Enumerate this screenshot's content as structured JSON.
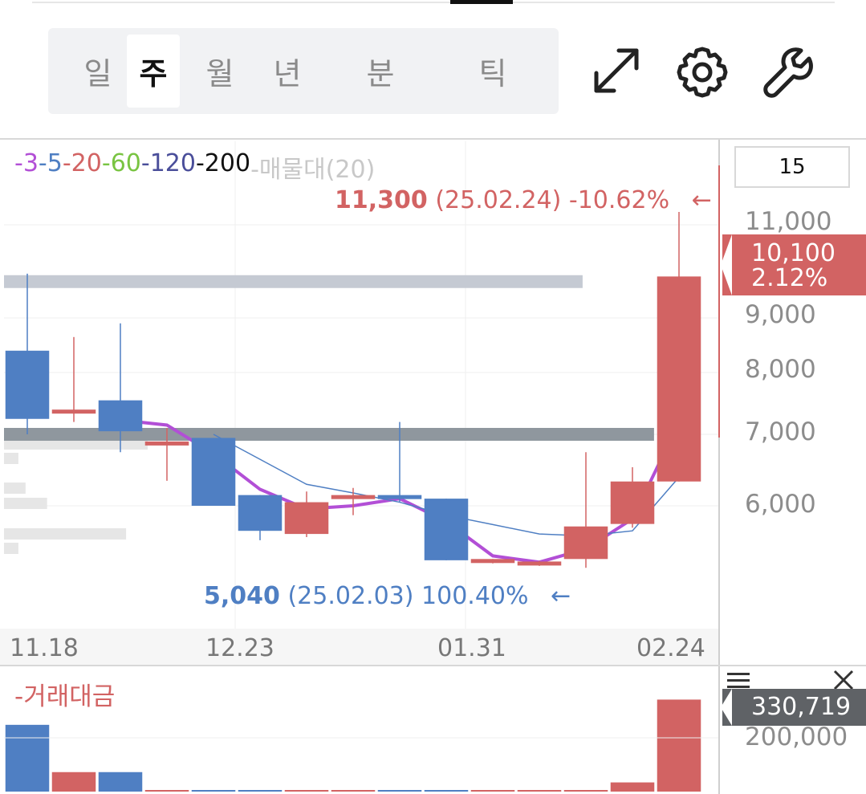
{
  "periods": {
    "items": [
      "일",
      "주",
      "월",
      "년",
      "분",
      "틱"
    ],
    "active": "주"
  },
  "toolbar": {
    "expand_icon": "expand-arrows-icon",
    "settings_icon": "gear-icon",
    "tools_icon": "wrench-icon"
  },
  "legend": {
    "items": [
      {
        "label": "3",
        "color": "#b24fd6"
      },
      {
        "label": "5",
        "color": "#4f7fc3"
      },
      {
        "label": "20",
        "color": "#d26363"
      },
      {
        "label": "60",
        "color": "#79c442"
      },
      {
        "label": "120",
        "color": "#4a4e9a"
      },
      {
        "label": "200",
        "color": "#111111"
      },
      {
        "label": "매물대(20)",
        "color": "#c8c8c8"
      }
    ]
  },
  "count_box": "15",
  "high_marker": {
    "price": "11,300",
    "date": "(25.02.24)",
    "pct": "-10.62%",
    "arrow": "←"
  },
  "low_marker": {
    "price": "5,040",
    "date": "(25.02.03)",
    "pct": "100.40%",
    "arrow": "←"
  },
  "current": {
    "price": "10,100",
    "pct": "2.12%",
    "color": "#d26363"
  },
  "volume_panel": {
    "title": "거래대금",
    "current": "330,719",
    "tick": "200,000",
    "menu_icon": "hamburger-icon",
    "close_icon": "close-icon"
  },
  "colors": {
    "up": "#d26363",
    "down": "#4f7fc3",
    "ma3": "#b24fd6",
    "ma5": "#4f7fc3"
  },
  "chart_data": [
    {
      "type": "candlestick",
      "x_ticks": [
        "11.18",
        "12.23",
        "01.31",
        "02.24"
      ],
      "y_ticks": [
        11000,
        9000,
        8000,
        7000,
        6000
      ],
      "ylim": [
        4500,
        11800
      ],
      "candles": [
        {
          "open": 8400,
          "high": 9950,
          "low": 7000,
          "close": 7250
        },
        {
          "open": 7400,
          "high": 8650,
          "low": 7200,
          "close": 7400
        },
        {
          "open": 7550,
          "high": 8900,
          "low": 6750,
          "close": 7050
        },
        {
          "open": 6850,
          "high": 7100,
          "low": 6350,
          "close": 6900
        },
        {
          "open": 6950,
          "high": 6950,
          "low": 6000,
          "close": 6000
        },
        {
          "open": 6150,
          "high": 6150,
          "low": 5450,
          "close": 5600
        },
        {
          "open": 5550,
          "high": 6200,
          "low": 5500,
          "close": 6050
        },
        {
          "open": 6100,
          "high": 6250,
          "low": 5850,
          "close": 6150
        },
        {
          "open": 6150,
          "high": 7200,
          "low": 6050,
          "close": 6100
        },
        {
          "open": 6100,
          "high": 6100,
          "low": 5130,
          "close": 5130
        },
        {
          "open": 5150,
          "high": 5150,
          "low": 5080,
          "close": 5150
        },
        {
          "open": 5110,
          "high": 5120,
          "low": 5040,
          "close": 5110
        },
        {
          "open": 5150,
          "high": 6750,
          "low": 5010,
          "close": 5670
        },
        {
          "open": 5710,
          "high": 6540,
          "low": 5650,
          "close": 6340
        },
        {
          "open": 6340,
          "high": 11300,
          "low": 6340,
          "close": 9890
        }
      ],
      "ma": [
        {
          "name": "3",
          "values": [
            null,
            null,
            7230,
            7150,
            6730,
            6230,
            5950,
            6000,
            6100,
            5750,
            5200,
            5100,
            5310,
            5790,
            7200
          ]
        },
        {
          "name": "5",
          "values": [
            null,
            null,
            null,
            null,
            7000,
            6650,
            6300,
            6180,
            6050,
            5850,
            5700,
            5550,
            5520,
            5600,
            6400
          ]
        }
      ],
      "volume_profile_bands": [
        {
          "price": 9780,
          "strength": 0.81,
          "color": "#c5cad3"
        },
        {
          "price": 7000,
          "strength": 0.91,
          "color": "#8f979e"
        }
      ]
    },
    {
      "type": "bar",
      "title": "거래대금",
      "values": [
        240000,
        70000,
        70000,
        3000,
        3000,
        3000,
        3000,
        3000,
        3000,
        3000,
        3000,
        3000,
        3000,
        33000,
        330719
      ],
      "ylim": [
        0,
        400000
      ],
      "y_ticks": [
        200000
      ]
    }
  ]
}
